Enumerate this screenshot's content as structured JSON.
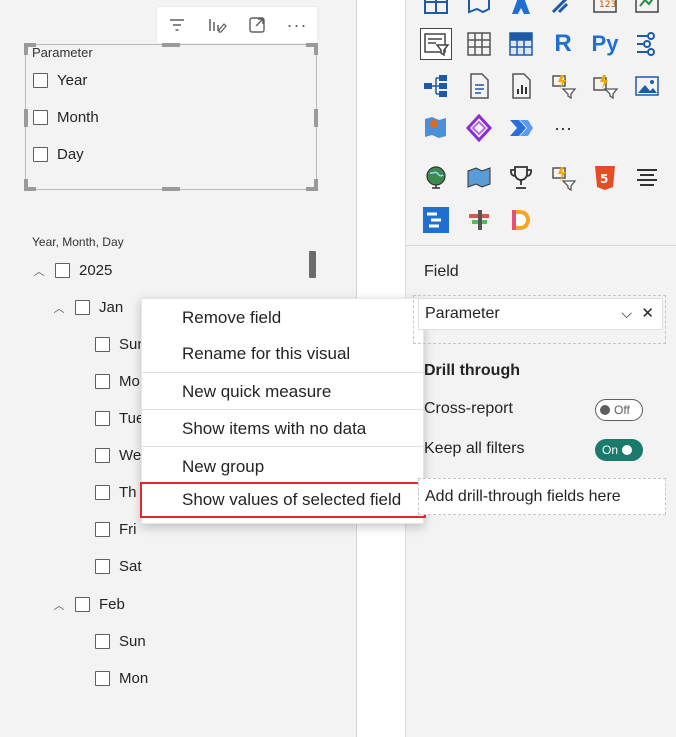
{
  "slicer": {
    "title": "Parameter",
    "items": [
      "Year",
      "Month",
      "Day"
    ]
  },
  "hierarchy": {
    "title": "Year, Month, Day",
    "year": "2025",
    "month1": "Jan",
    "days1": [
      "Sun",
      "Mo",
      "Tue",
      "We",
      "Th",
      "Fri",
      "Sat"
    ],
    "month2": "Feb",
    "days2": [
      "Sun",
      "Mon"
    ]
  },
  "context_menu": {
    "items": [
      "Remove field",
      "Rename for this visual",
      "New quick measure",
      "Show items with no data",
      "New group",
      "Show values of selected field"
    ],
    "highlight_color": "#e5272b"
  },
  "toolbar": {
    "icons": [
      "filter-icon",
      "visual-format-icon",
      "focus-mode-icon",
      "more-options-icon"
    ],
    "more_label": "···"
  },
  "pane": {
    "field_label": "Field",
    "field_value": "Parameter",
    "drill_title": "Drill through",
    "cross_report_label": "Cross-report",
    "cross_report_state": "Off",
    "keep_filters_label": "Keep all filters",
    "keep_filters_state": "On",
    "drill_placeholder": "Add drill-through fields here",
    "viz_R": "R",
    "viz_Py": "Py",
    "viz_more": "···",
    "toggle_on_color": "#1a7a6b"
  }
}
